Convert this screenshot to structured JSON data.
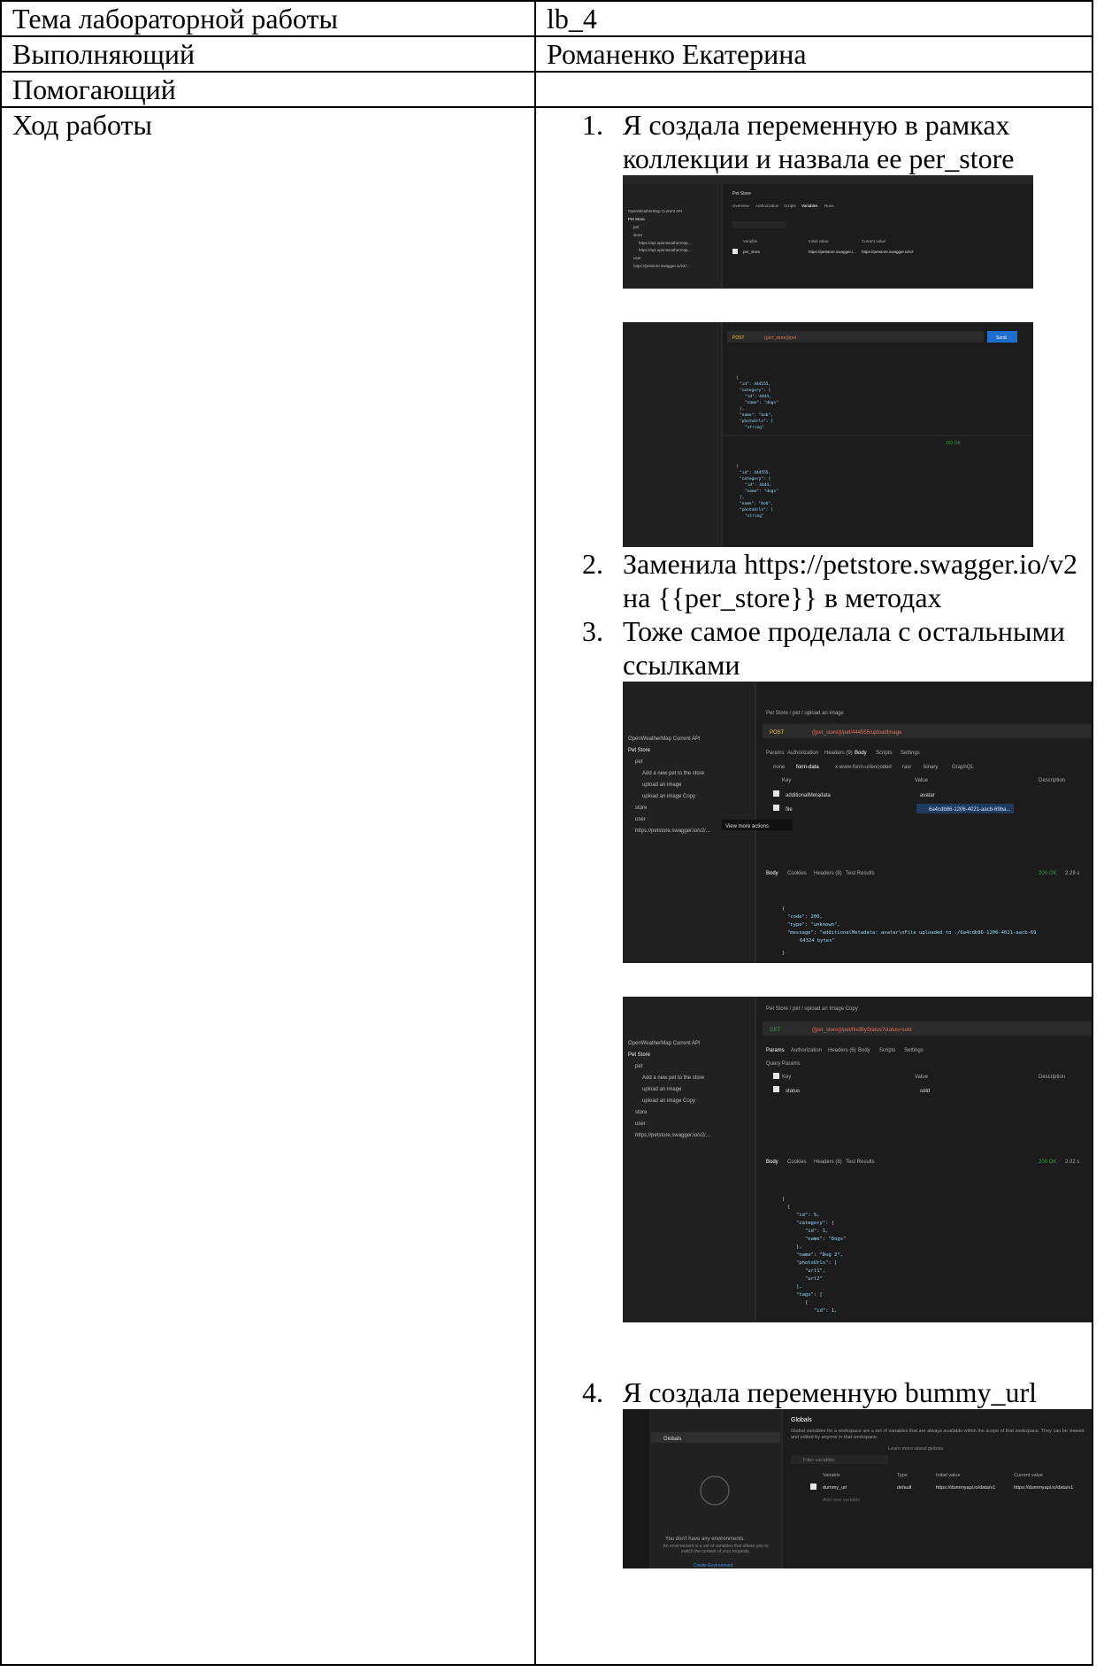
{
  "rows": [
    {
      "label": "Тема лабораторной работы",
      "value": "lb_4"
    },
    {
      "label": "Выполняющий",
      "value": "Романенко Екатерина"
    },
    {
      "label": "Помогающий",
      "value": ""
    },
    {
      "label": "Ход работы"
    }
  ],
  "steps": [
    {
      "num": "1.",
      "text": "Я создала переменную в рамках коллекции и назвала ее per_store"
    },
    {
      "num": "2.",
      "text": "Заменила  https://petstore.swagger.io/v2 на {{per_store}} в методах"
    },
    {
      "num": "3.",
      "text": "Тоже самое проделала с остальными ссылками"
    },
    {
      "num": "4.",
      "text": "Я создала переменную bummy_url"
    }
  ],
  "screenshots": {
    "s1": {
      "tab": "Pet Store",
      "sidebar": [
        "OpenWeatherMap Current API",
        "Pet Store",
        "pet",
        "store",
        "https://api.openweathermap...",
        "https://api.openweathermap...",
        "user",
        "https://petstore.swagger.io/v2/..."
      ],
      "tabs": [
        "Overview",
        "Authorization",
        "Scripts",
        "Variables",
        "Runs"
      ],
      "columns": [
        "Variable",
        "Initial value",
        "Current value"
      ],
      "row": [
        "per_store",
        "https://petstore.swagger.i...",
        "https://petstore.swagger.io/v2"
      ]
    },
    "s2": {
      "method": "POST",
      "url": "{{per_store}}/pet",
      "send": "Send",
      "body_lines": [
        "{",
        "\"id\": 444555,",
        "\"category\": {",
        "\"id\": 4444,",
        "\"name\": \"dogs\"",
        "},",
        "\"name\": \"bob\",",
        "\"photoUrls\": [",
        "\"string\""
      ],
      "status": "200 OK"
    },
    "s3": {
      "crumb": "Pet Store / pet / upload an image",
      "method": "POST",
      "url": "{{per_store}}/pet/444555/uploadImage",
      "sidebar": [
        "OpenWeatherMap Current API",
        "Pet Store",
        "pet",
        "Add a new pet to the store",
        "upload an image",
        "upload an image Copy",
        "store",
        "user",
        "https://petstore.swagger.io/v2/..."
      ],
      "tabs": [
        "Params",
        "Authorization",
        "Headers (9)",
        "Body",
        "Scripts",
        "Settings"
      ],
      "body_types": [
        "none",
        "form-data",
        "x-www-form-urlencoded",
        "raw",
        "binary",
        "GraphQL"
      ],
      "columns": [
        "Key",
        "Value",
        "Description"
      ],
      "rows": [
        [
          "additionalMetadata",
          "avatar"
        ],
        [
          "file",
          "6a4cdb86-1206-4021-aacb-69ba..."
        ]
      ],
      "tooltip": "View more actions",
      "resp_tabs": [
        "Body",
        "Cookies",
        "Headers (8)",
        "Test Results"
      ],
      "status": "200 OK",
      "time": "2.29 s",
      "resp_lines": [
        "{",
        "\"code\": 200,",
        "\"type\": \"unknown\",",
        "\"message\": \"additionalMetadata: avatar\\nFile uploaded to ./6a4cdb86-1206-4021-aacb-69",
        "64324 bytes\"",
        "}"
      ]
    },
    "s4": {
      "crumb": "Pet Store / pet / upload an Image Copy",
      "method": "GET",
      "url": "{{per_store}}/pet/findByStatus?status=sold",
      "tabs": [
        "Params",
        "Authorization",
        "Headers (6)",
        "Body",
        "Scripts",
        "Settings"
      ],
      "query_label": "Query Params",
      "columns": [
        "Key",
        "Value",
        "Description"
      ],
      "row": [
        "status",
        "sold"
      ],
      "status": "200 OK",
      "time": "2.02 s",
      "resp_lines": [
        "[",
        "{",
        "\"id\": 5,",
        "\"category\": {",
        "\"id\": 1,",
        "\"name\": \"Dogs\"",
        "},",
        "\"name\": \"Dog 2\",",
        "\"photoUrls\": [",
        "\"url1\",",
        "\"url2\"",
        "],",
        "\"tags\": [",
        "{",
        "\"id\": 1,"
      ]
    },
    "s5": {
      "title": "Globals",
      "left": "Globals",
      "desc": "Global variables for a workspace are a set of variables that are always available within the scope of that workspace. They can be viewed and edited by anyone in that workspace.",
      "learn": "Learn more about globals",
      "filter": "Filter variables",
      "columns": [
        "Variable",
        "Type",
        "Initial value",
        "Current value"
      ],
      "row": [
        "dummy_url",
        "default",
        "https://dummyapi.io/data/v1",
        "https://dummyapi.io/data/v1"
      ],
      "add": "Add new variable",
      "empty_title": "You don't have any environments.",
      "empty_desc": "An environment is a set of variables that allows you to switch the context of your requests.",
      "create": "Create Environment"
    }
  }
}
